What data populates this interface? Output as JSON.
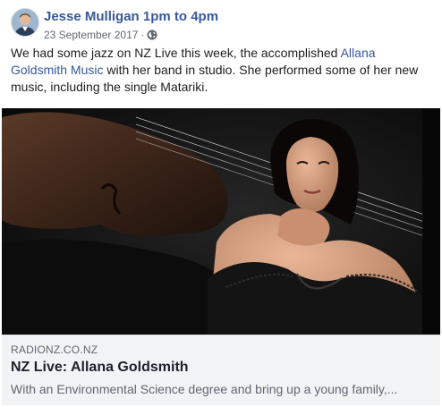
{
  "post": {
    "author": "Jesse Mulligan 1pm to 4pm",
    "date": "23 September 2017",
    "separator": "·",
    "privacy_icon": "globe-icon",
    "text_before": "We had some jazz on NZ Live this week, the accomplished ",
    "link_text": "Allana Goldsmith Music",
    "text_after": " with her band in studio. She performed some of her new music, including the single Matariki."
  },
  "link_preview": {
    "domain": "RADIONZ.CO.NZ",
    "title": "NZ Live: Allana Goldsmith",
    "description": "With an Environmental Science degree and bring up a young family,..."
  },
  "colors": {
    "link": "#385898",
    "text": "#1c1e21",
    "muted": "#606770",
    "preview_bg": "#f2f3f5"
  }
}
